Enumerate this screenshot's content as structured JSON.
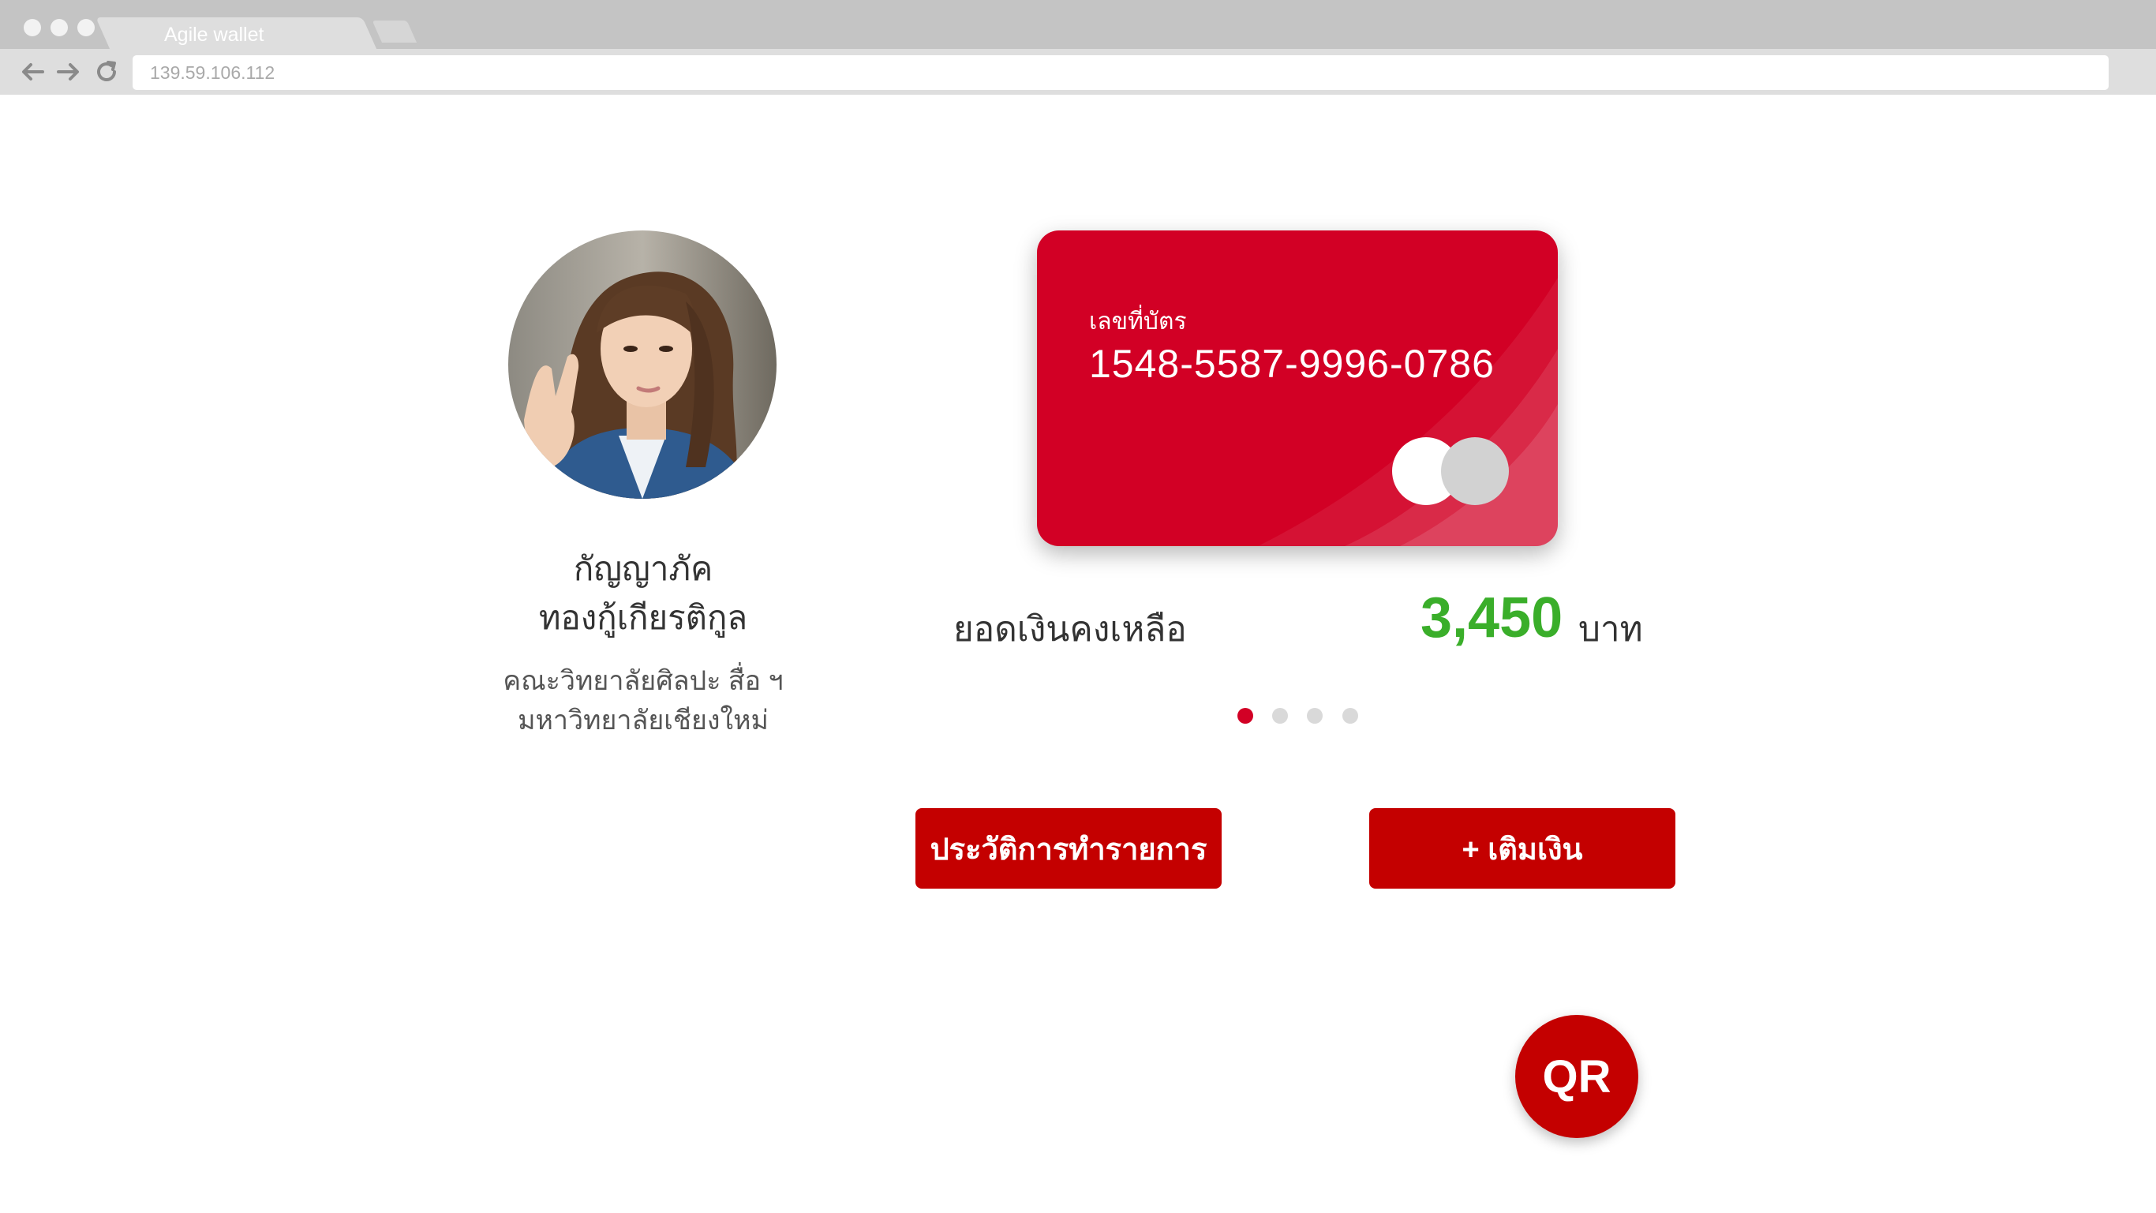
{
  "browser": {
    "tab_title": "Agile wallet",
    "url": "139.59.106.112"
  },
  "profile": {
    "name_line1": "กัญญาภัค",
    "name_line2": "ทองกู้เกียรติกูล",
    "faculty": "คณะวิทยาลัยศิลปะ สื่อ ฯ",
    "university": "มหาวิทยาลัยเชียงใหม่"
  },
  "card": {
    "label": "เลขที่บัตร",
    "number": "1548-5587-9996-0786",
    "color": "#d20025"
  },
  "balance": {
    "label": "ยอดเงินคงเหลือ",
    "amount": "3,450",
    "unit": "บาท",
    "amount_color": "#3aae2a"
  },
  "carousel": {
    "total": 4,
    "active_index": 0
  },
  "actions": {
    "history_label": "ประวัติการทำรายการ",
    "topup_label": "+ เติมเงิน",
    "qr_label": "QR"
  },
  "theme": {
    "primary": "#c40000"
  }
}
